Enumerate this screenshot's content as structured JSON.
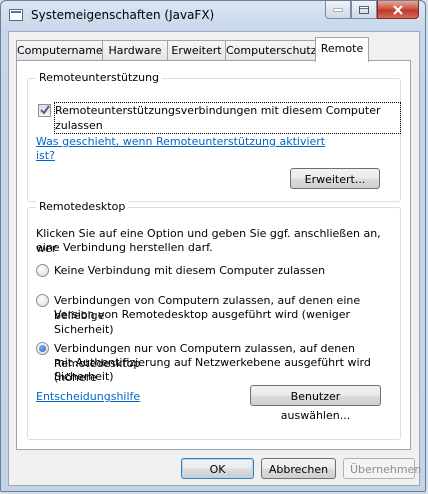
{
  "window": {
    "title": "Systemeigenschaften (JavaFX)"
  },
  "tabs": [
    {
      "label": "Computername"
    },
    {
      "label": "Hardware"
    },
    {
      "label": "Erweitert"
    },
    {
      "label": "Computerschutz"
    },
    {
      "label": "Remote",
      "active": true
    }
  ],
  "remote_assistance": {
    "title": "Remoteunterstützung",
    "checkbox_label": "Remoteunterstützungsverbindungen mit diesem Computer zulassen",
    "checked": true,
    "help_link_line1": "Was geschieht, wenn Remoteunterstützung aktiviert",
    "help_link_line2": "ist?",
    "advanced_button": "Erweitert..."
  },
  "remote_desktop": {
    "title": "Remotedesktop",
    "description_line1": "Klicken Sie auf eine Option und geben Sie ggf. anschließen an, wer",
    "description_line2": "eine Verbindung herstellen darf.",
    "options": [
      {
        "lines": [
          "Keine Verbindung mit diesem Computer zulassen"
        ],
        "checked": false
      },
      {
        "lines": [
          "Verbindungen von Computern zulassen, auf denen eine beliebige",
          "Version von Remotedesktop ausgeführt wird (weniger Sicherheit)"
        ],
        "checked": false
      },
      {
        "lines": [
          "Verbindungen nur von Computern zulassen, auf denen Remotedesktop",
          "mit Authentifizierung auf Netzwerkebene ausgeführt wird (höhere",
          "Sicherheit)"
        ],
        "checked": true
      }
    ],
    "help_link": "Entscheidungshilfe",
    "select_users_button": "Benutzer auswählen..."
  },
  "footer": {
    "ok": "OK",
    "cancel": "Abbrechen",
    "apply": "Übernehmen"
  },
  "colors": {
    "link": "#0066cc",
    "accent": "#1c5fae"
  }
}
